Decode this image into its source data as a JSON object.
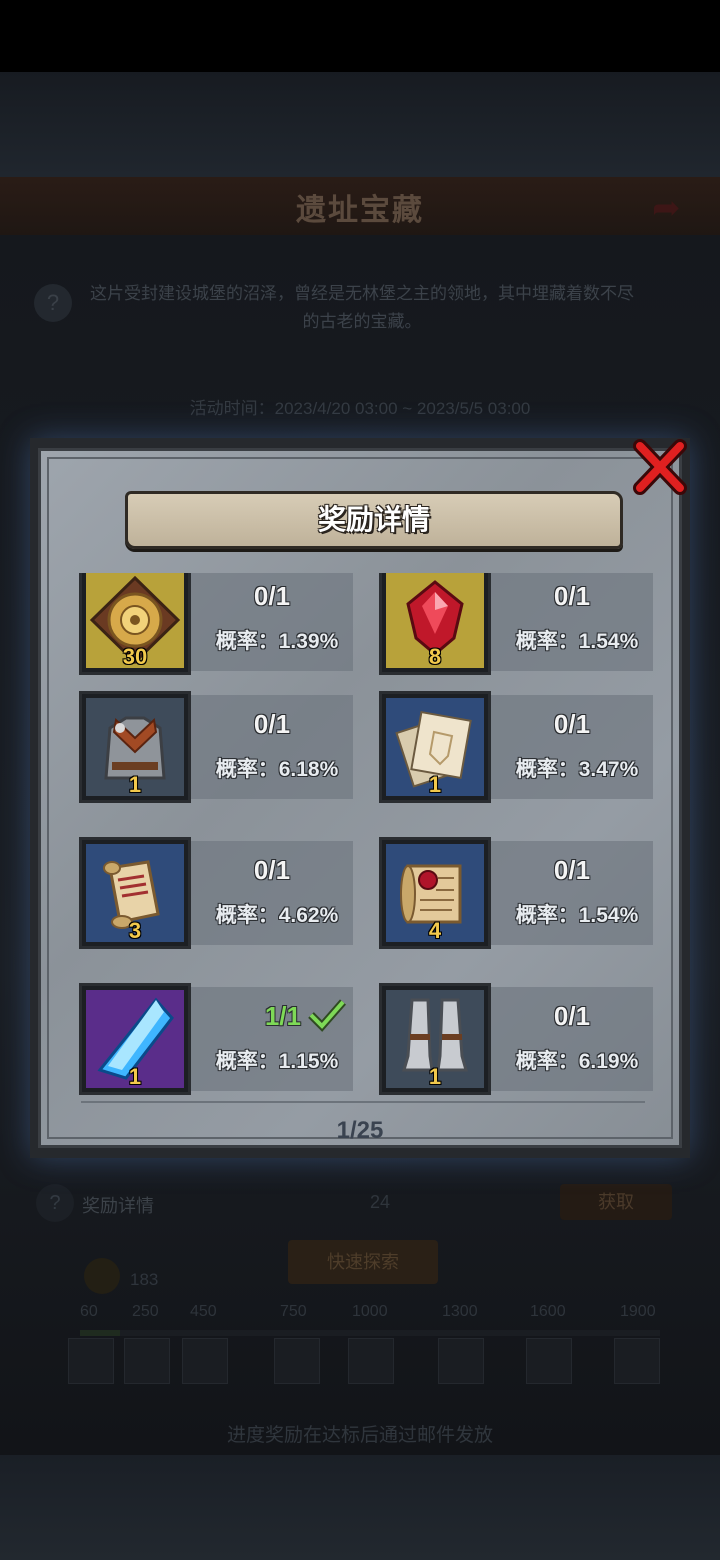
{
  "background": {
    "title": "遗址宝藏",
    "description": "这片受封建设城堡的沼泽，曾经是无林堡之主的领地，其中埋藏着数不尽的古老的宝藏。",
    "event_time": "活动时间：2023/4/20 03:00 ~ 2023/5/5 03:00",
    "reward_label": "奖励详情",
    "reward_count": "24",
    "get_button": "获取",
    "quick_explore": "快速探索",
    "points": "183",
    "milestones": [
      "60",
      "250",
      "450",
      "750",
      "1000",
      "1300",
      "1600",
      "1900"
    ],
    "footer": "进度奖励在达标后通过邮件发放"
  },
  "modal": {
    "title": "奖励详情",
    "page": "1/25",
    "rewards": [
      {
        "icon": "golden-medallion-icon",
        "qty": "30",
        "progress": "0/1",
        "rate": "概率：1.39%",
        "bg": "#b8a23a",
        "done": false
      },
      {
        "icon": "red-gem-icon",
        "qty": "8",
        "progress": "0/1",
        "rate": "概率：1.54%",
        "bg": "#b8a23a",
        "done": false
      },
      {
        "icon": "chainmail-armor-icon",
        "qty": "1",
        "progress": "0/1",
        "rate": "概率：6.18%",
        "bg": "#3e4b5a",
        "done": false
      },
      {
        "icon": "blueprint-papers-icon",
        "qty": "1",
        "progress": "0/1",
        "rate": "概率：3.47%",
        "bg": "#2f4b7a",
        "done": false
      },
      {
        "icon": "scroll-icon",
        "qty": "3",
        "progress": "0/1",
        "rate": "概率：4.62%",
        "bg": "#2f4b7a",
        "done": false
      },
      {
        "icon": "sealed-scroll-icon",
        "qty": "4",
        "progress": "0/1",
        "rate": "概率：1.54%",
        "bg": "#2f4b7a",
        "done": false
      },
      {
        "icon": "blue-crystal-icon",
        "qty": "1",
        "progress": "1/1",
        "rate": "概率：1.15%",
        "bg": "#5a2d8a",
        "done": true
      },
      {
        "icon": "steel-greaves-icon",
        "qty": "1",
        "progress": "0/1",
        "rate": "概率：6.19%",
        "bg": "#3e4b5a",
        "done": false
      }
    ]
  }
}
